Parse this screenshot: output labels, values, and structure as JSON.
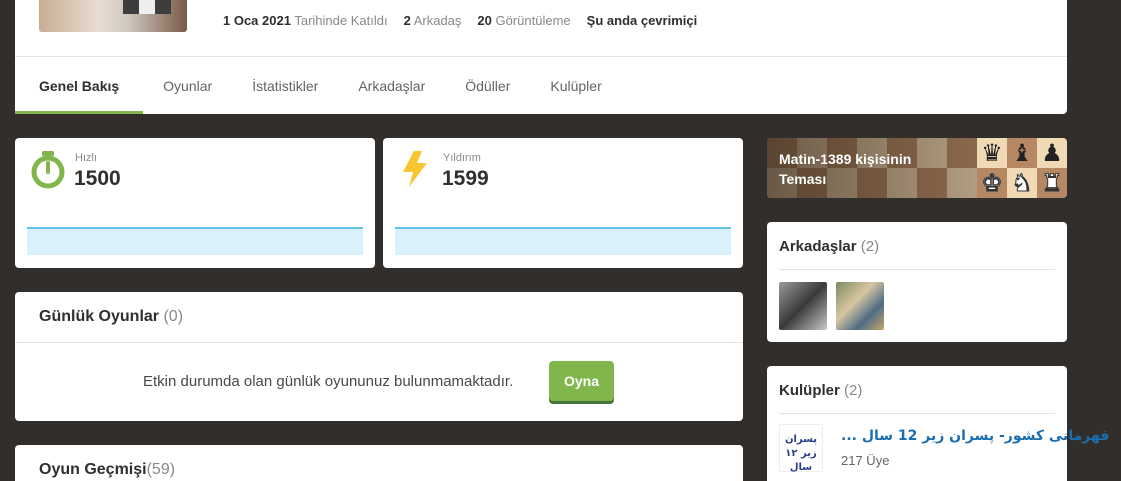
{
  "header": {
    "joined_date": "1 Oca 2021",
    "joined_label": "Tarihinde Katıldı",
    "friends_count": "2",
    "friends_label": "Arkadaş",
    "views_count": "20",
    "views_label": "Görüntüleme",
    "status": "Şu anda çevrimiçi"
  },
  "tabs": [
    {
      "label": "Genel Bakış",
      "active": true
    },
    {
      "label": "Oyunlar"
    },
    {
      "label": "İstatistikler"
    },
    {
      "label": "Arkadaşlar"
    },
    {
      "label": "Ödüller"
    },
    {
      "label": "Kulüpler"
    }
  ],
  "ratings": {
    "rapid": {
      "label": "Hızlı",
      "value": "1500",
      "icon": "stopwatch-icon",
      "color": "#81b64c"
    },
    "blitz": {
      "label": "Yıldırım",
      "value": "1599",
      "icon": "lightning-icon",
      "color": "#f7c631"
    }
  },
  "daily": {
    "title": "Günlük Oyunlar",
    "count": "(0)",
    "message": "Etkin durumda olan günlük oyununuz bulunmamaktadır.",
    "play_button": "Oyna"
  },
  "history": {
    "title": "Oyun Geçmişi",
    "count": "(59)"
  },
  "theme": {
    "title": "Matin-1389 kişisinin Teması"
  },
  "friends": {
    "title": "Arkadaşlar",
    "count": "(2)"
  },
  "clubs": {
    "title": "Kulüpler",
    "count": "(2)",
    "items": [
      {
        "name": "... قهرمانی کشور- پسران زیر 12 سال",
        "members": "217 Üye",
        "logo_text": "پسران زیر ۱۲ سال"
      }
    ]
  },
  "colors": {
    "accent": "#81b64c",
    "background": "#312e2b",
    "graph": "#62c4e8"
  }
}
